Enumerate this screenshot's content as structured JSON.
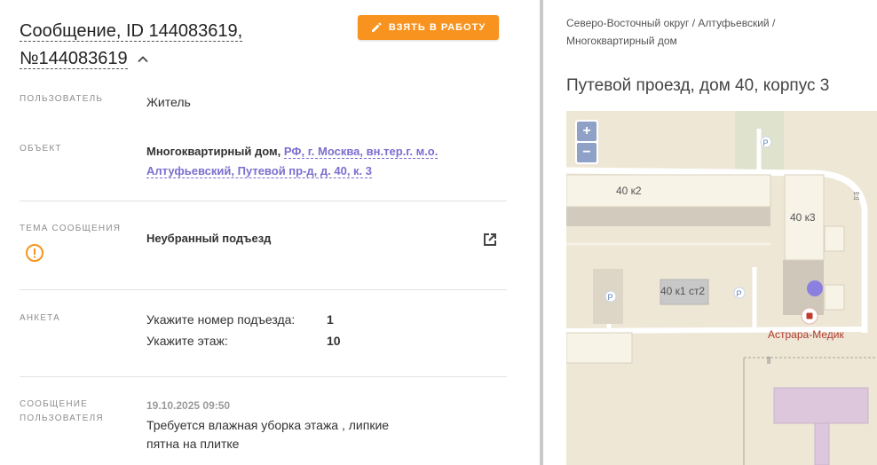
{
  "header": {
    "title": "Сообщение, ID 144083619,",
    "title_line2": "№144083619",
    "take_button": "ВЗЯТЬ В РАБОТУ"
  },
  "fields": {
    "user": {
      "label": "ПОЛЬЗОВАТЕЛЬ",
      "value": "Житель"
    },
    "object": {
      "label": "ОБЪЕКТ",
      "prefix": "Многоквартирный дом,",
      "link_line1": "РФ, г. Москва, вн.тер.г. м.о.",
      "link_line2": "Алтуфьевский, Путевой пр-д, д. 40, к. 3"
    },
    "topic": {
      "label": "ТЕМА СООБЩЕНИЯ",
      "value": "Неубранный подъезд"
    },
    "survey": {
      "label": "АНКЕТА",
      "rows": [
        {
          "q": "Укажите номер подъезда:",
          "a": "1"
        },
        {
          "q": "Укажите этаж:",
          "a": "10"
        }
      ]
    },
    "message": {
      "label_line1": "СООБЩЕНИЕ",
      "label_line2": "ПОЛЬЗОВАТЕЛЯ",
      "date": "19.10.2025 09:50",
      "text_line1": "Требуется влажная уборка этажа , липкие",
      "text_line2": "пятна на плитке"
    }
  },
  "right": {
    "breadcrumb_line1": "Северо-Восточный округ / Алтуфьевский /",
    "breadcrumb_line2": "Многоквартирный дом",
    "address": "Путевой проезд, дом 40, корпус 3"
  },
  "map": {
    "zoom_in": "+",
    "zoom_out": "−",
    "labels": {
      "b1": "40 к2",
      "b2": "40 к3",
      "b3": "40 к1 ст2",
      "poi": "Астрара-Медик",
      "parking": "P"
    }
  },
  "colors": {
    "accent": "#f7931e",
    "link": "#7b6fcf",
    "alert": "#f7931e",
    "map_bg": "#eee7d6",
    "marker": "#8b7fe0",
    "poi": "#c0392b"
  }
}
